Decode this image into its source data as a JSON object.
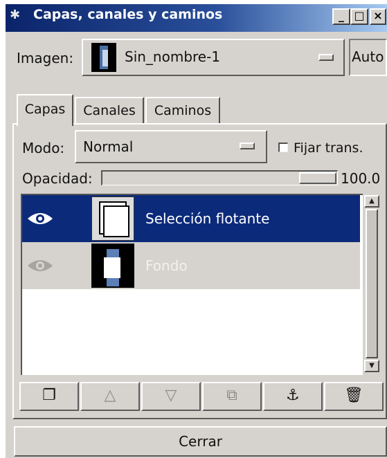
{
  "window": {
    "title": "Capas, canales y caminos",
    "controls": {
      "minimize": "_",
      "maximize": "□",
      "close": "×"
    }
  },
  "image_row": {
    "label": "Imagen:",
    "selected_image": "Sin_nombre-1",
    "auto_label": "Auto"
  },
  "tabs": [
    {
      "label": "Capas",
      "active": true
    },
    {
      "label": "Canales",
      "active": false
    },
    {
      "label": "Caminos",
      "active": false
    }
  ],
  "mode": {
    "label": "Modo:",
    "value": "Normal",
    "keep_trans_label": "Fijar trans.",
    "keep_trans_checked": false
  },
  "opacity": {
    "label": "Opacidad:",
    "value_text": "100.0",
    "value": 100
  },
  "layers": [
    {
      "name": "Selección flotante",
      "visible": true,
      "selected": true
    },
    {
      "name": "Fondo",
      "visible": true,
      "selected": false
    }
  ],
  "toolbar": {
    "buttons": [
      {
        "icon": "new-layer-icon",
        "glyph": "❐",
        "enabled": true
      },
      {
        "icon": "raise-layer-icon",
        "glyph": "△",
        "enabled": false
      },
      {
        "icon": "lower-layer-icon",
        "glyph": "▽",
        "enabled": false
      },
      {
        "icon": "duplicate-layer-icon",
        "glyph": "⧉",
        "enabled": false
      },
      {
        "icon": "anchor-layer-icon",
        "glyph": "⚓",
        "enabled": true
      },
      {
        "icon": "delete-layer-icon",
        "glyph": "🗑",
        "enabled": true
      }
    ]
  },
  "close_button": {
    "label": "Cerrar"
  },
  "colors": {
    "title_bar": "#0a246a",
    "selection": "#0c2a7a",
    "panel": "#d6d3ce"
  }
}
